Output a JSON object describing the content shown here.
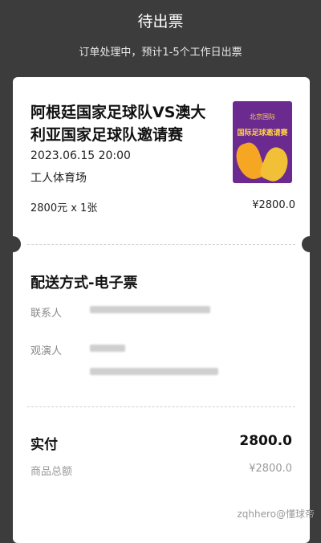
{
  "header": {
    "title": "待出票",
    "subtitle": "订单处理中，预计1-5个工作日出票"
  },
  "ticket": {
    "event_title": "阿根廷国家足球队VS澳大利亚国家足球队邀请赛",
    "date_time": "2023.06.15 20:00",
    "venue": "工人体育场",
    "price_line": "2800元 x 1张",
    "price_total": "¥2800.0",
    "poster": {
      "header_text": "北京国际",
      "title_text": "国际足球邀请赛"
    }
  },
  "delivery": {
    "title": "配送方式-电子票",
    "contact_label": "联系人",
    "attendee_label": "观演人"
  },
  "payment": {
    "paid_label": "实付",
    "paid_value": "2800.0",
    "goods_label": "商品总额",
    "goods_value": "¥2800.0"
  },
  "watermark": "zqhhero@懂球帝"
}
